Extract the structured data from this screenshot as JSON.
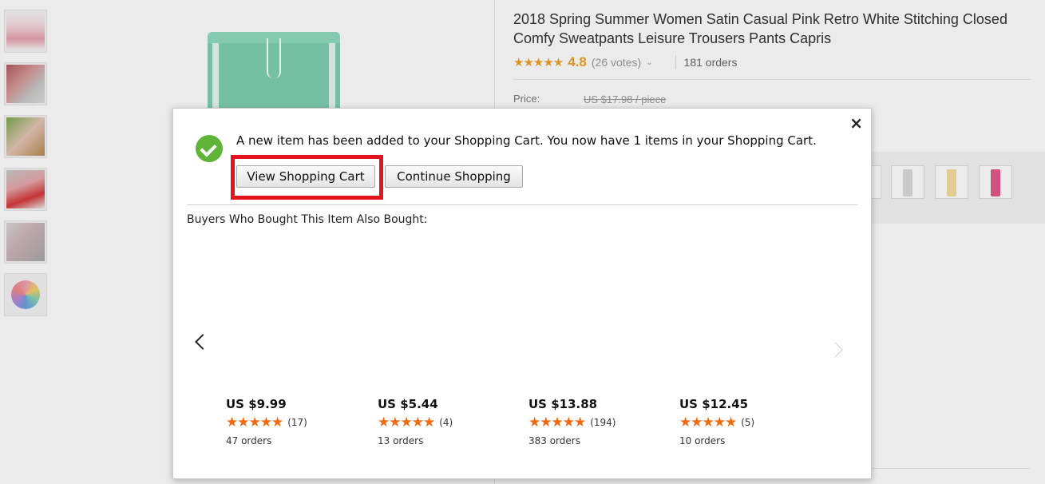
{
  "product": {
    "title": "2018 Spring Summer Women Satin Casual Pink Retro White Stitching Closed Comfy Sweatpants Leisure Trousers Pants Capris",
    "stars": "★★★★★",
    "score": "4.8",
    "votes": "(26 votes)",
    "caret": "⌄",
    "orders": "181 orders",
    "price_label": "Price:",
    "price_old": "US $17.98 / piece"
  },
  "modal": {
    "close": "×",
    "message": "A new item has been added to your Shopping Cart. You now have 1 items in your Shopping Cart.",
    "view_cart_label": "View Shopping Cart",
    "continue_label": "Continue Shopping",
    "also_bought_heading": "Buyers Who Bought This Item Also Bought:",
    "recommendations": [
      {
        "price": "US $9.99",
        "stars": "★★★★★",
        "count": "(17)",
        "orders": "47 orders"
      },
      {
        "price": "US $5.44",
        "stars": "★★★★★",
        "count": "(4)",
        "orders": "13 orders"
      },
      {
        "price": "US $13.88",
        "stars": "★★★★★",
        "count": "(194)",
        "orders": "383 orders"
      },
      {
        "price": "US $12.45",
        "stars": "★★★★★",
        "count": "(5)",
        "orders": "10 orders"
      }
    ]
  },
  "colors": {
    "highlight": "#e5131d",
    "star_orange": "#f26a10",
    "check_green": "#5fb336"
  }
}
